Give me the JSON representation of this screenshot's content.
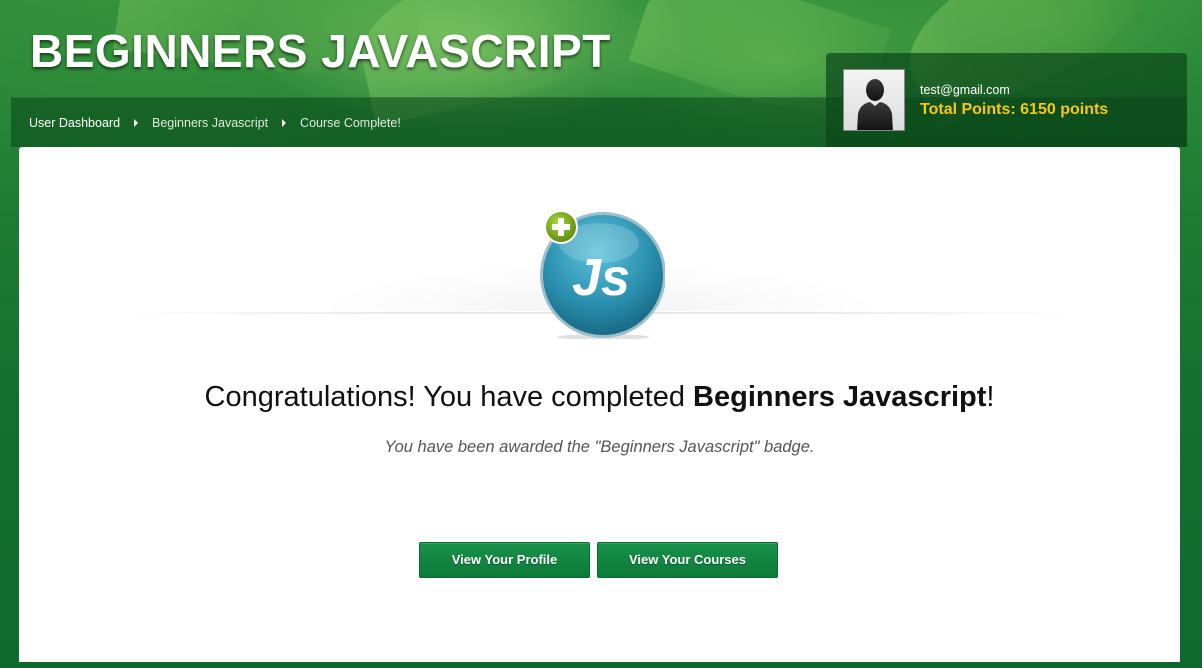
{
  "header": {
    "site_title": "BEGINNERS JAVASCRIPT"
  },
  "breadcrumb": {
    "items": [
      "User Dashboard",
      "Beginners Javascript",
      "Course Complete!"
    ]
  },
  "user": {
    "email": "test@gmail.com",
    "points_label": "Total Points:",
    "points_value": "6150 points",
    "avatar_icon": "user-silhouette-icon"
  },
  "badge": {
    "icon": "js-badge-icon",
    "text": "Js",
    "plus_icon": "plus-icon"
  },
  "main": {
    "congrats_prefix": "Congratulations! You have completed ",
    "congrats_course": "Beginners Javascript",
    "congrats_suffix": "!",
    "awarded_text": "You have been awarded the \"Beginners Javascript\" badge.",
    "buttons": {
      "profile_label": "View Your Profile",
      "courses_label": "View Your Courses"
    }
  },
  "colors": {
    "accent_green": "#0d7a38",
    "points_yellow": "#f6c619",
    "badge_blue": "#2a8fae",
    "plus_green": "#7aaa1e"
  }
}
